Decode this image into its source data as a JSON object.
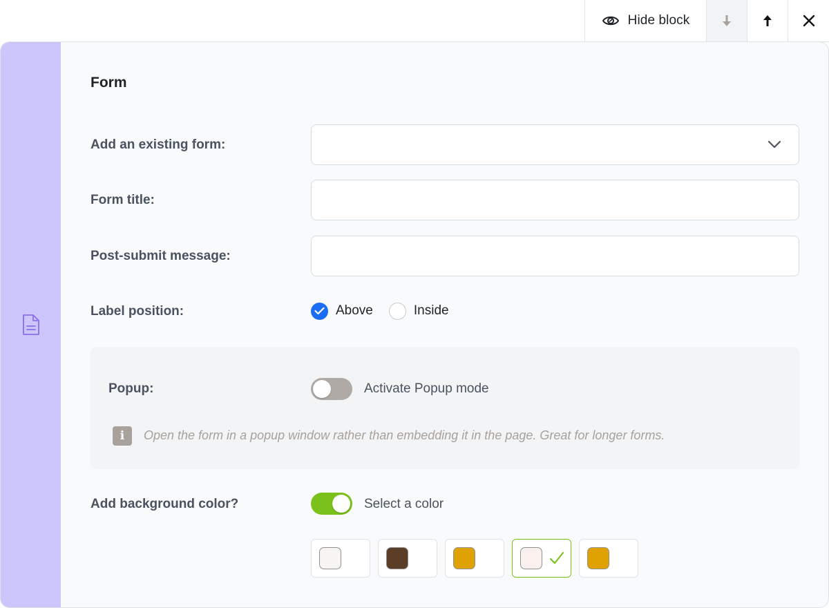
{
  "toolbar": {
    "hide_label": "Hide block",
    "icons": [
      "eye-icon",
      "arrow-down-icon",
      "arrow-up-icon",
      "close-icon"
    ]
  },
  "block": {
    "side_icon": "document-icon",
    "title": "Form",
    "fields": {
      "existing_form": {
        "label": "Add an existing form:",
        "value": "",
        "icon": "chevron-down-icon"
      },
      "form_title": {
        "label": "Form title:",
        "value": ""
      },
      "post_submit": {
        "label": "Post-submit message:",
        "value": ""
      }
    },
    "label_position": {
      "label": "Label position:",
      "options": [
        {
          "label": "Above",
          "selected": true
        },
        {
          "label": "Inside",
          "selected": false
        }
      ]
    },
    "popup": {
      "label": "Popup:",
      "toggle_label": "Activate Popup mode",
      "enabled": false,
      "info_icon": "i",
      "info": "Open the form in a popup window rather than embedding it in the page. Great for longer forms."
    },
    "background": {
      "label": "Add background color?",
      "toggle_label": "Select a color",
      "enabled": true,
      "swatches": [
        {
          "color": "#f7f5f1",
          "selected": false
        },
        {
          "color": "#5c3d26",
          "selected": false
        },
        {
          "color": "#e0a102",
          "selected": false
        },
        {
          "color": "#faf1ee",
          "selected": true
        },
        {
          "color": "#e0a102",
          "selected": false
        }
      ]
    }
  },
  "colors": {
    "accent_blue": "#1b6ef3",
    "accent_green": "#7ac11c",
    "sidebar": "#cdc6fd"
  }
}
